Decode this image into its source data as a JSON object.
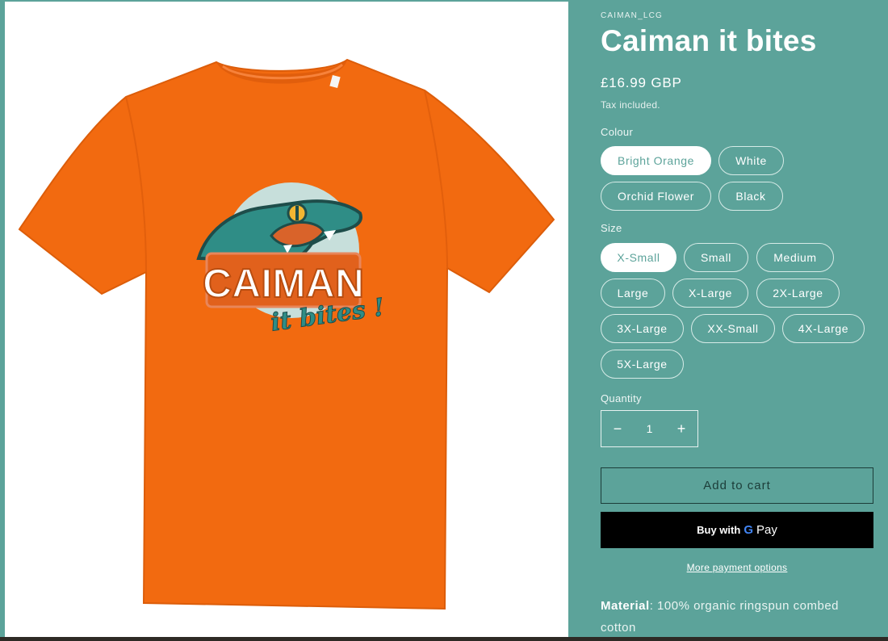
{
  "product": {
    "vendor": "CAIMAN_LCG",
    "title": "Caiman it bites",
    "price": "£16.99 GBP",
    "tax_note": "Tax included.",
    "image_alt": "Bright orange t-shirt with CAIMAN it bites! logo",
    "logo_word": "CAIMAN",
    "logo_tagline": "it bites !"
  },
  "colour": {
    "label": "Colour",
    "options": [
      "Bright Orange",
      "White",
      "Orchid Flower",
      "Black"
    ],
    "selected": "Bright Orange"
  },
  "size": {
    "label": "Size",
    "options": [
      "X-Small",
      "Small",
      "Medium",
      "Large",
      "X-Large",
      "2X-Large",
      "3X-Large",
      "XX-Small",
      "4X-Large",
      "5X-Large"
    ],
    "selected": "X-Small"
  },
  "quantity": {
    "label": "Quantity",
    "value": "1",
    "minus": "−",
    "plus": "+"
  },
  "actions": {
    "add_to_cart": "Add to cart",
    "buy_with": "Buy with",
    "gpay_g": "G",
    "gpay_pay": "Pay",
    "more_payment": "More payment options"
  },
  "description": {
    "material_label": "Material",
    "material_text": ": 100% organic ringspun combed cotton"
  },
  "colors": {
    "page_bg": "#5ca39a",
    "shirt": "#f26a10",
    "logo_teal": "#2f8d86"
  }
}
